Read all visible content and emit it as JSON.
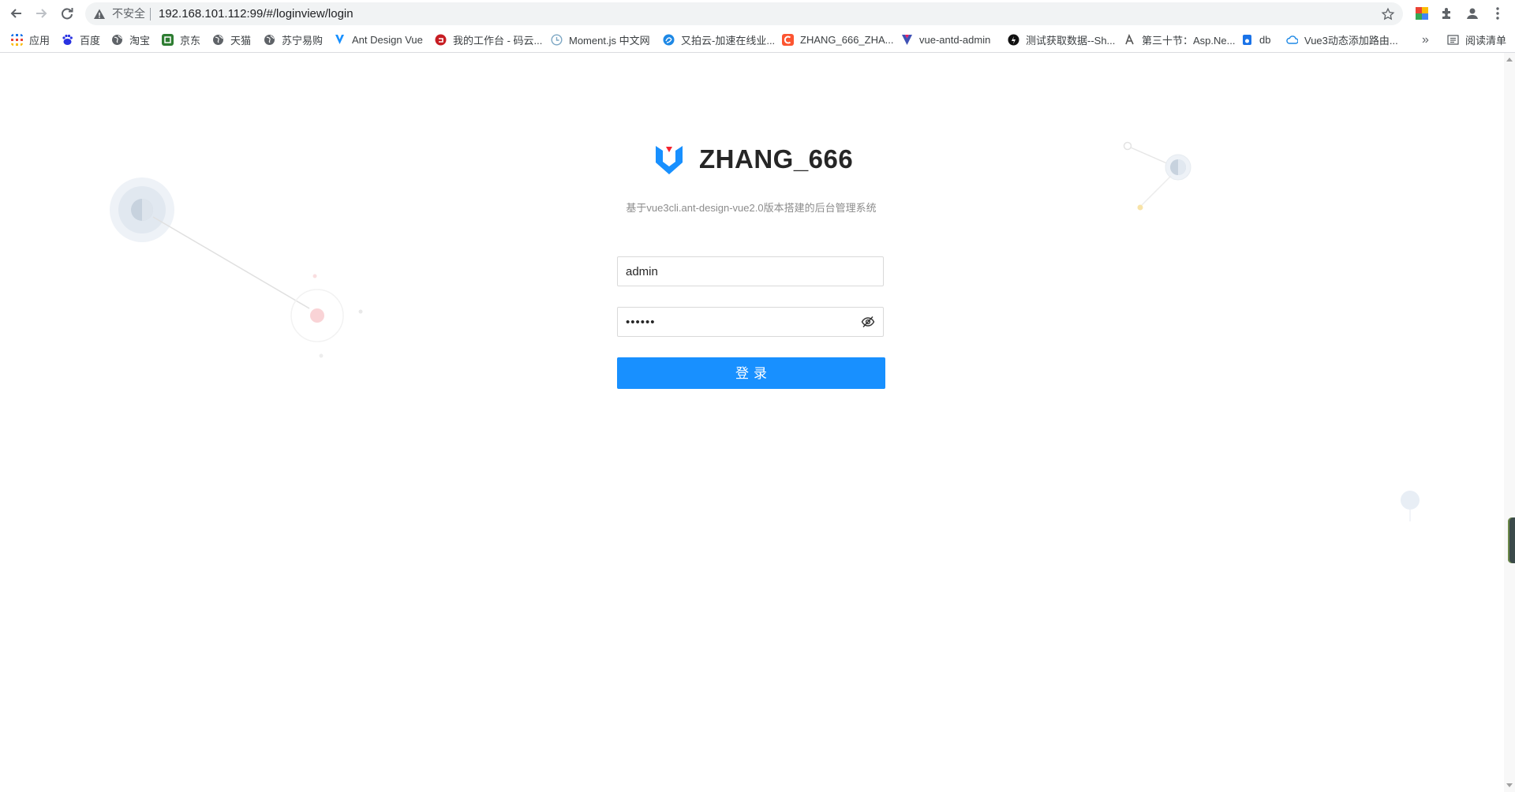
{
  "browser": {
    "security_label": "不安全",
    "url": "192.168.101.112:99/#/loginview/login",
    "bookmarks": [
      {
        "label": "应用",
        "icon": "apps-grid-icon"
      },
      {
        "label": "百度",
        "icon": "baidu-icon"
      },
      {
        "label": "淘宝",
        "icon": "globe-icon"
      },
      {
        "label": "京东",
        "icon": "jd-icon"
      },
      {
        "label": "天猫",
        "icon": "globe-icon"
      },
      {
        "label": "苏宁易购",
        "icon": "globe-icon"
      },
      {
        "label": "Ant Design Vue",
        "icon": "antdv-icon"
      },
      {
        "label": "我的工作台 - 码云...",
        "icon": "gitee-icon"
      },
      {
        "label": "Moment.js 中文网",
        "icon": "clock-icon"
      },
      {
        "label": "又拍云-加速在线业...",
        "icon": "upyun-icon"
      },
      {
        "label": "ZHANG_666_ZHA...",
        "icon": "csdn-icon"
      },
      {
        "label": "vue-antd-admin",
        "icon": "vue-icon"
      },
      {
        "label": "测试获取数据--Sh...",
        "icon": "dark-circle-icon"
      },
      {
        "label": "第三十节：Asp.Ne...",
        "icon": "blog-icon"
      },
      {
        "label": "db",
        "icon": "db-icon"
      },
      {
        "label": "Vue3动态添加路由...",
        "icon": "cloud-icon"
      }
    ],
    "more_label": "»",
    "reading_list_label": "阅读清单"
  },
  "colors": {
    "primary": "#1890ff",
    "title": "#262626",
    "subtitle": "#8c8c8c",
    "logo_blue": "#1890ff",
    "logo_red": "#f5222d"
  },
  "login": {
    "title": "ZHANG_666",
    "subtitle": "基于vue3cli.ant-design-vue2.0版本搭建的后台管理系统",
    "username_value": "admin",
    "password_value": "••••••",
    "submit_label": "登录"
  }
}
